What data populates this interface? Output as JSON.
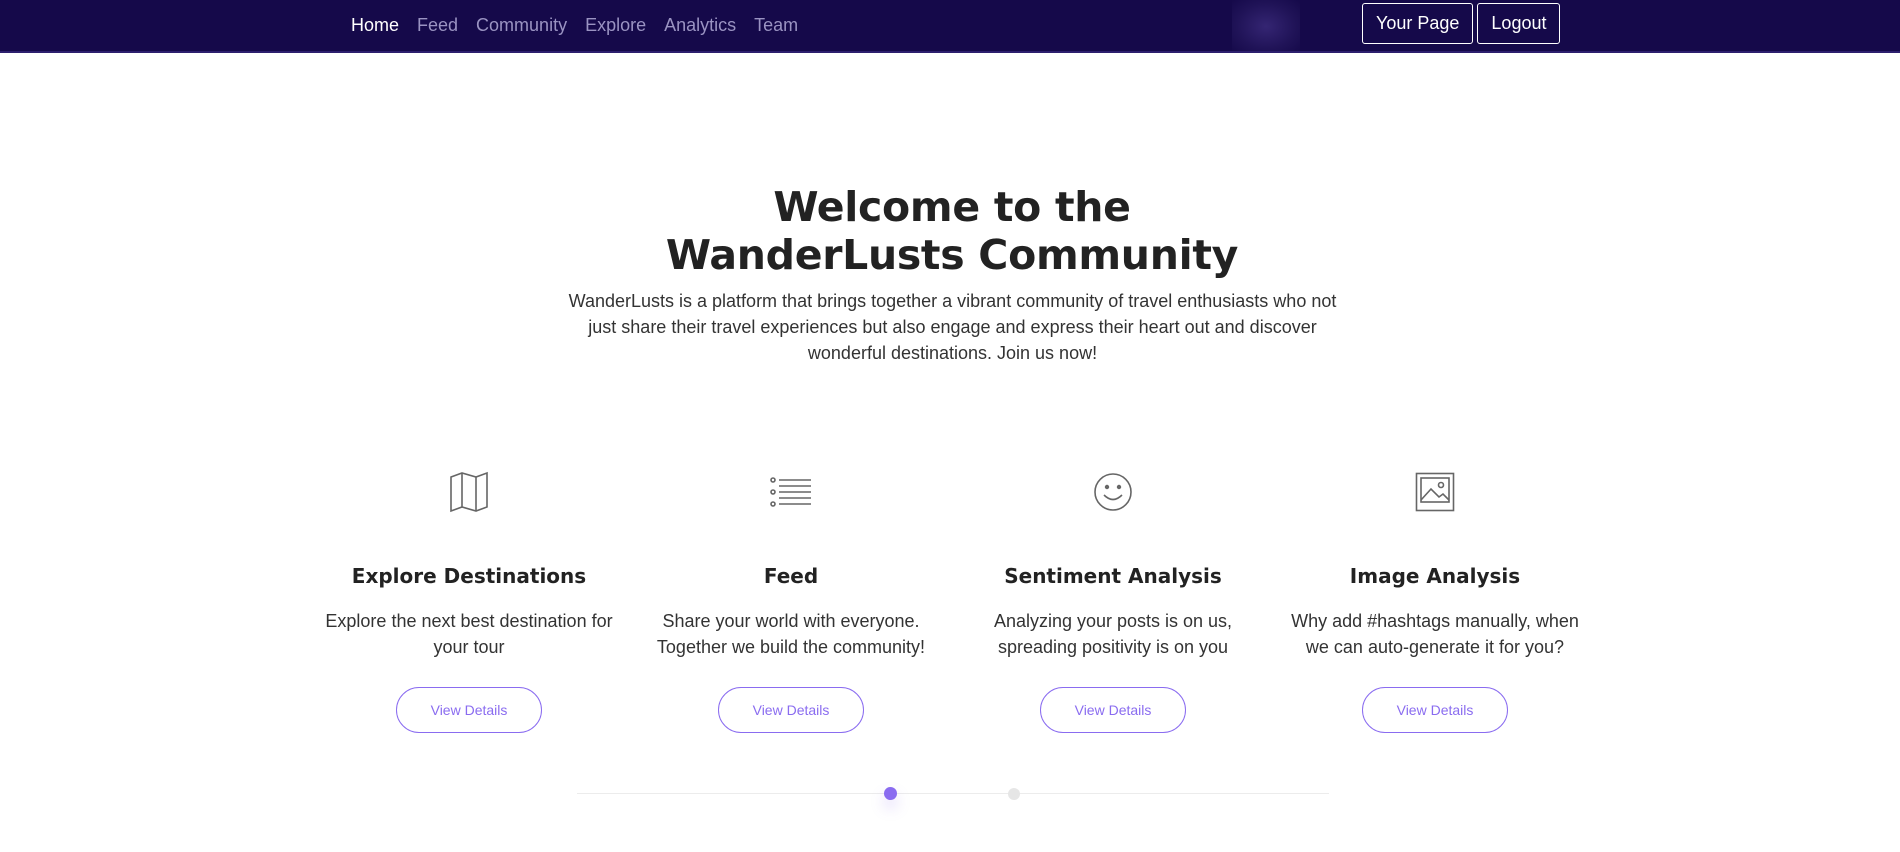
{
  "nav": {
    "links": [
      {
        "label": "Home",
        "active": true
      },
      {
        "label": "Feed",
        "active": false
      },
      {
        "label": "Community",
        "active": false
      },
      {
        "label": "Explore",
        "active": false
      },
      {
        "label": "Analytics",
        "active": false
      },
      {
        "label": "Team",
        "active": false
      }
    ],
    "your_page_label": "Your Page",
    "logout_label": "Logout",
    "background_color": "#15094a"
  },
  "hero": {
    "title": "Welcome to the WanderLusts Community",
    "description": "WanderLusts is a platform that brings together a vibrant community of travel enthusiasts who not just share their travel experiences but also engage and express their heart out and discover wonderful destinations. Join us now!"
  },
  "features": [
    {
      "icon": "map-icon",
      "title": "Explore Destinations",
      "text": "Explore the next best destination for your tour",
      "button": "View Details"
    },
    {
      "icon": "list-icon",
      "title": "Feed",
      "text": "Share your world with everyone. Together we build the community!",
      "button": "View Details"
    },
    {
      "icon": "smiley-icon",
      "title": "Sentiment Analysis",
      "text": "Analyzing your posts is on us, spreading positivity is on you",
      "button": "View Details"
    },
    {
      "icon": "image-icon",
      "title": "Image Analysis",
      "text": "Why add #hashtags manually, when we can auto-generate it for you?",
      "button": "View Details"
    }
  ],
  "carousel": {
    "page_count": 2,
    "active_index": 0
  },
  "colors": {
    "accent": "#8a6cf0",
    "heading": "#222222"
  }
}
